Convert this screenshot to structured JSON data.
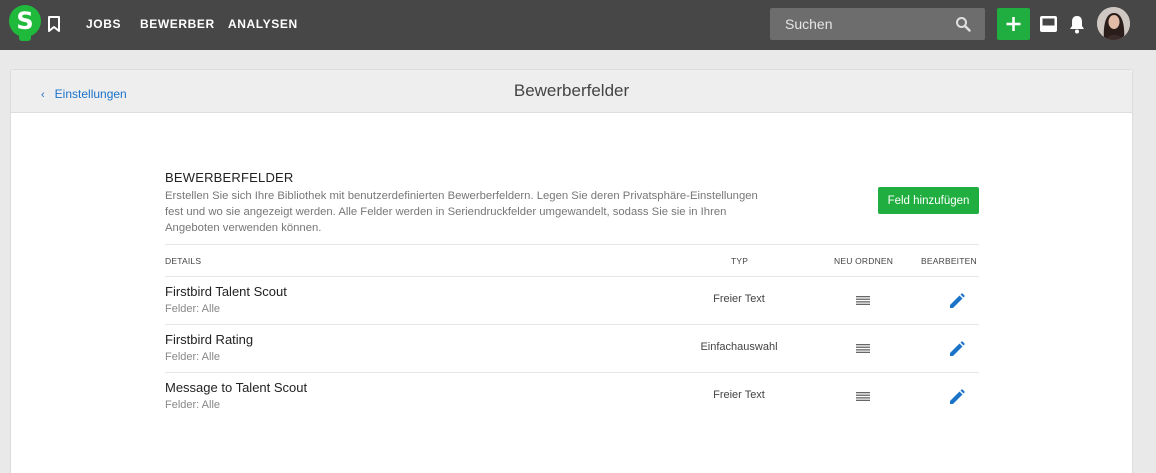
{
  "nav": {
    "logo_letter": "S",
    "items": [
      {
        "label": "JOBS"
      },
      {
        "label": "BEWERBER"
      },
      {
        "label": "ANALYSEN"
      }
    ],
    "search_placeholder": "Suchen"
  },
  "icons": [
    "logo-icon",
    "bookmark-icon",
    "search-icon",
    "plus-icon",
    "inbox-icon",
    "bell-icon",
    "drag-handle-icon",
    "edit-pencil-icon",
    "chevron-left-icon"
  ],
  "colors": {
    "topbar": "#474747",
    "accent_green": "#1fae3f",
    "link_blue": "#1a73c9"
  },
  "header": {
    "back_label": "Einstellungen",
    "title": "Bewerberfelder"
  },
  "section": {
    "title": "BEWERBERFELDER",
    "description": "Erstellen Sie sich Ihre Bibliothek mit benutzerdefinierten Bewerberfeldern. Legen Sie deren Privatsphäre-Einstellungen fest und wo sie angezeigt werden. Alle Felder werden in Seriendruckfelder umgewandelt, sodass Sie sie in Ihren Angeboten verwenden können.",
    "add_button": "Feld hinzufügen"
  },
  "table": {
    "columns": [
      "DETAILS",
      "TYP",
      "NEU ORDNEN",
      "BEARBEITEN"
    ],
    "rows": [
      {
        "name": "Firstbird Talent Scout",
        "fields": "Felder: Alle",
        "type": "Freier Text"
      },
      {
        "name": "Firstbird Rating",
        "fields": "Felder: Alle",
        "type": "Einfachauswahl"
      },
      {
        "name": "Message to Talent Scout",
        "fields": "Felder: Alle",
        "type": "Freier Text"
      }
    ]
  }
}
